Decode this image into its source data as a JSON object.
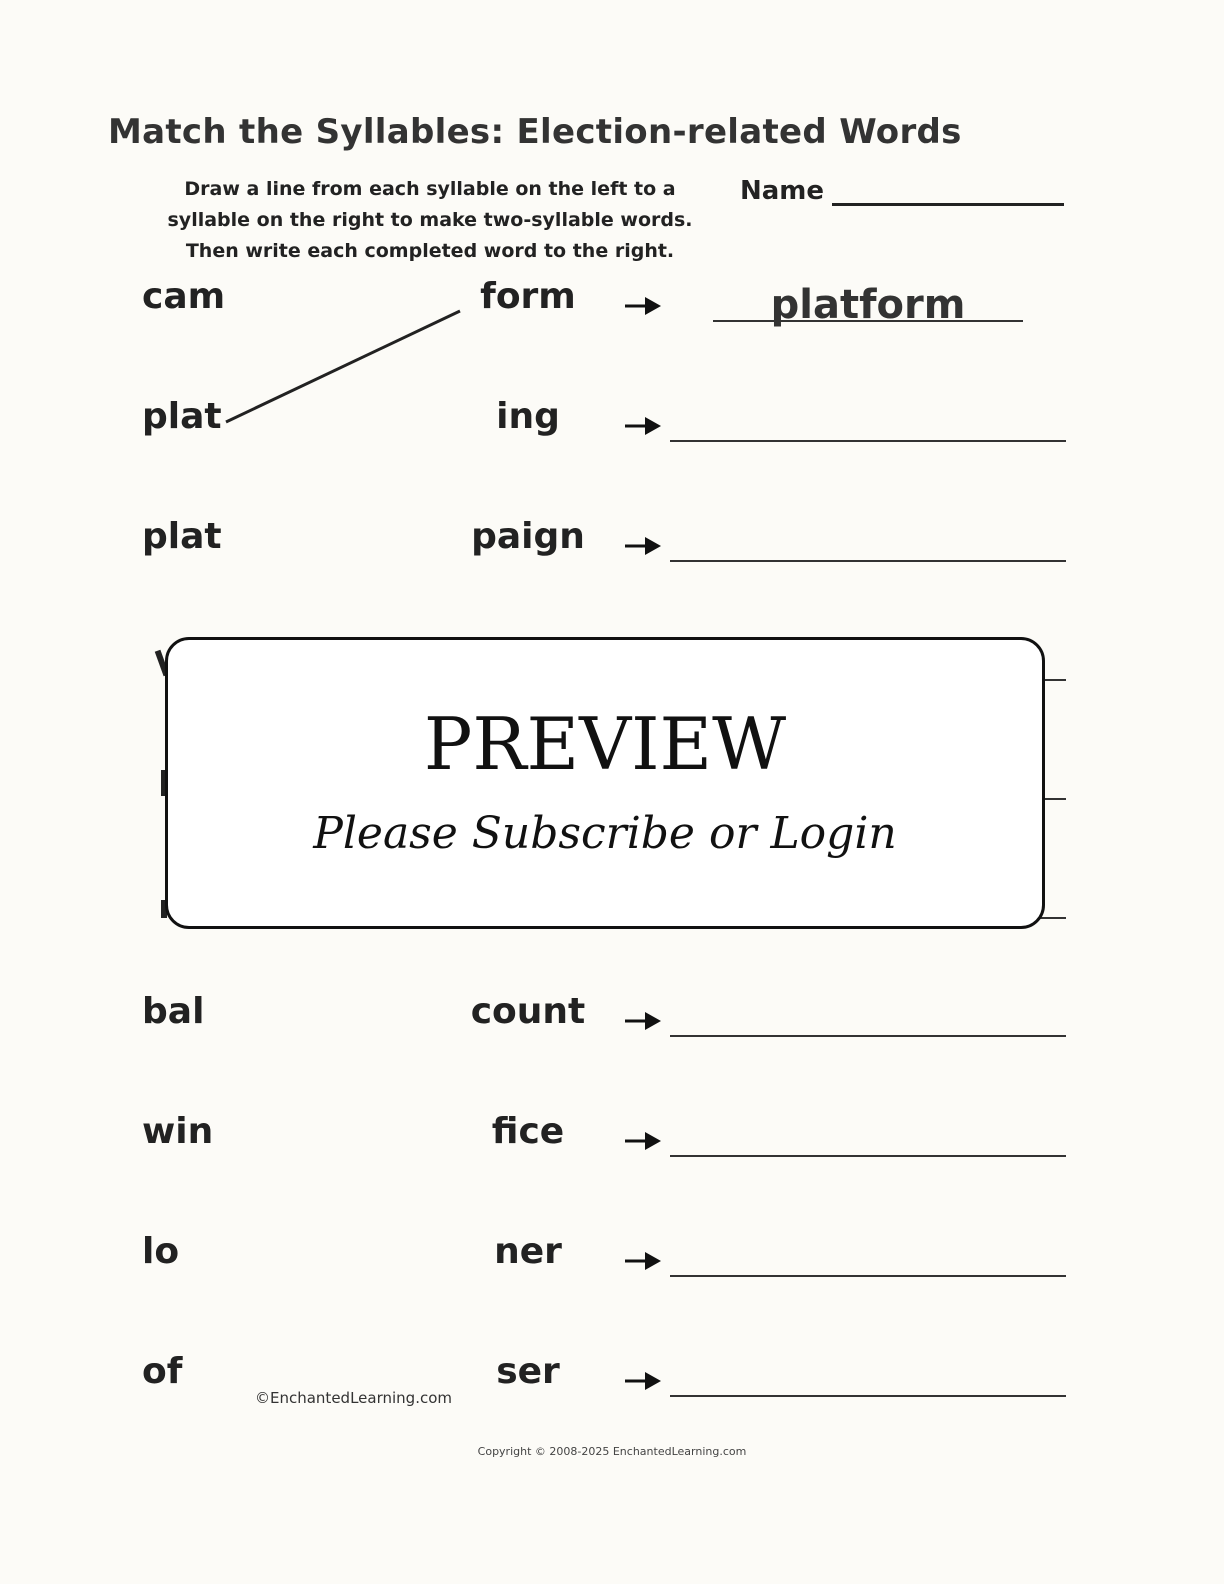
{
  "title": "Match the Syllables: Election-related Words",
  "instructions": [
    "Draw a line from each syllable on the left to a",
    "syllable on the right to make two-syllable words.",
    "Then write each completed word to the right."
  ],
  "name_label": "Name",
  "rows": [
    {
      "left": "cam",
      "right": "form",
      "answer": "platform"
    },
    {
      "left": "plat",
      "right": "ing",
      "answer": ""
    },
    {
      "left": "plat",
      "right": "paign",
      "answer": ""
    },
    {
      "left": "bal",
      "right": "count",
      "answer": ""
    },
    {
      "left": "win",
      "right": "fice",
      "answer": ""
    },
    {
      "left": "lo",
      "right": "ner",
      "answer": ""
    },
    {
      "left": "of",
      "right": "ser",
      "answer": ""
    }
  ],
  "preview": {
    "title": "PREVIEW",
    "subtitle": "Please Subscribe or Login"
  },
  "credit": "©EnchantedLearning.com",
  "copyright": "Copyright © 2008-2025 EnchantedLearning.com"
}
